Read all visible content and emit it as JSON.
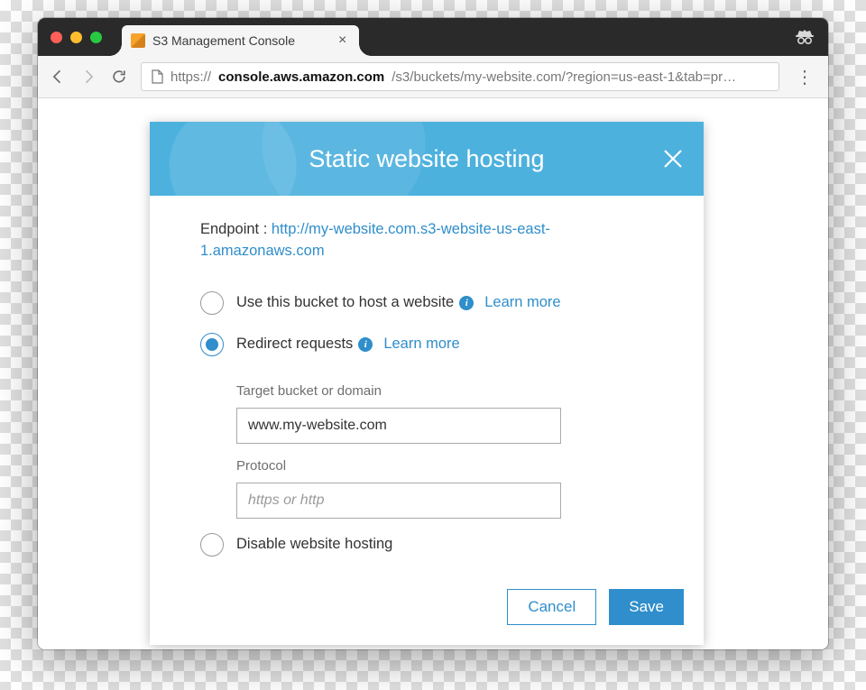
{
  "browser": {
    "tab_title": "S3 Management Console",
    "url_scheme": "https://",
    "url_host": "console.aws.amazon.com",
    "url_path": "/s3/buckets/my-website.com/?region=us-east-1&tab=pr…"
  },
  "dialog": {
    "title": "Static website hosting",
    "endpoint_label": "Endpoint : ",
    "endpoint_url": "http://my-website.com.s3-website-us-east-1.amazonaws.com",
    "options": {
      "host": {
        "label": "Use this bucket to host a website",
        "learn_more": "Learn more",
        "selected": false
      },
      "redirect": {
        "label": "Redirect requests",
        "learn_more": "Learn more",
        "selected": true,
        "target_label": "Target bucket or domain",
        "target_value": "www.my-website.com",
        "protocol_label": "Protocol",
        "protocol_placeholder": "https or http",
        "protocol_value": ""
      },
      "disable": {
        "label": "Disable website hosting",
        "selected": false
      }
    },
    "buttons": {
      "cancel": "Cancel",
      "save": "Save"
    }
  }
}
